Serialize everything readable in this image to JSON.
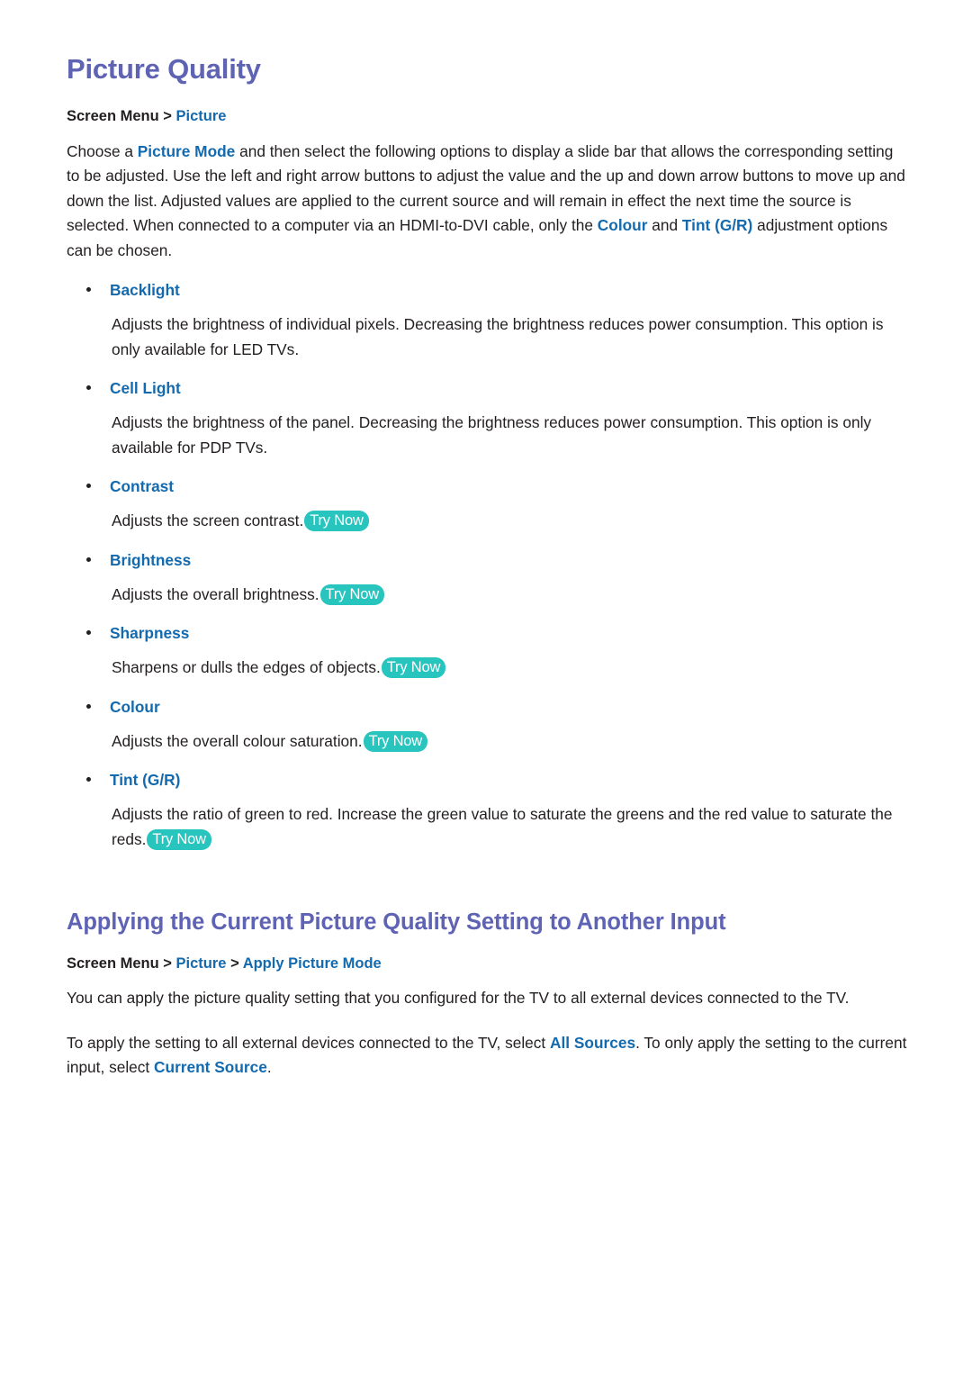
{
  "document": {
    "sections": [
      {
        "id": "picture-quality",
        "title": "Picture Quality",
        "breadcrumb": {
          "root": "Screen Menu",
          "separator": ">",
          "trail": [
            "Picture"
          ]
        },
        "intro": {
          "part1": "Choose a ",
          "kw1": "Picture Mode",
          "part2": " and then select the following options to display a slide bar that allows the corresponding setting to be adjusted. Use the left and right arrow buttons to adjust the value and the up and down arrow buttons to move up and down the list. Adjusted values are applied to the current source and will remain in effect the next time the source is selected. When connected to a computer via an HDMI-to-DVI cable, only the ",
          "kw2": "Colour",
          "part3": " and ",
          "kw3": "Tint (G/R)",
          "part4": " adjustment options can be chosen."
        },
        "options": [
          {
            "label": "Backlight",
            "description": "Adjusts the brightness of individual pixels. Decreasing the brightness reduces power consumption. This option is only available for LED TVs.",
            "try_now": false
          },
          {
            "label": "Cell Light",
            "description": "Adjusts the brightness of the panel. Decreasing the brightness reduces power consumption. This option is only available for PDP TVs.",
            "try_now": false
          },
          {
            "label": "Contrast",
            "description": "Adjusts the screen contrast.",
            "try_now": true
          },
          {
            "label": "Brightness",
            "description": "Adjusts the overall brightness.",
            "try_now": true
          },
          {
            "label": "Sharpness",
            "description": "Sharpens or dulls the edges of objects.",
            "try_now": true
          },
          {
            "label": "Colour",
            "description": "Adjusts the overall colour saturation.",
            "try_now": true
          },
          {
            "label": "Tint (G/R)",
            "description": "Adjusts the ratio of green to red. Increase the green value to saturate the greens and the red value to saturate the reds.",
            "try_now": true
          }
        ]
      },
      {
        "id": "apply-picture-mode",
        "title": "Applying the Current Picture Quality Setting to Another Input",
        "breadcrumb": {
          "root": "Screen Menu",
          "separator": ">",
          "trail": [
            "Picture",
            "Apply Picture Mode"
          ]
        },
        "paragraphs": [
          {
            "part1": "You can apply the picture quality setting that you configured for the TV to all external devices connected to the TV."
          },
          {
            "part1": "To apply the setting to all external devices connected to the TV, select ",
            "kw1": "All Sources",
            "part2": ". To only apply the setting to the current input, select ",
            "kw2": "Current Source",
            "part3": "."
          }
        ]
      }
    ],
    "badge": {
      "try_now_label": "Try Now"
    },
    "colors": {
      "heading": "#5f63b4",
      "link": "#136aae",
      "body": "#231f20",
      "badge_bg": "#28c4be",
      "badge_text": "#ffffff",
      "page_bg": "#ffffff"
    }
  }
}
